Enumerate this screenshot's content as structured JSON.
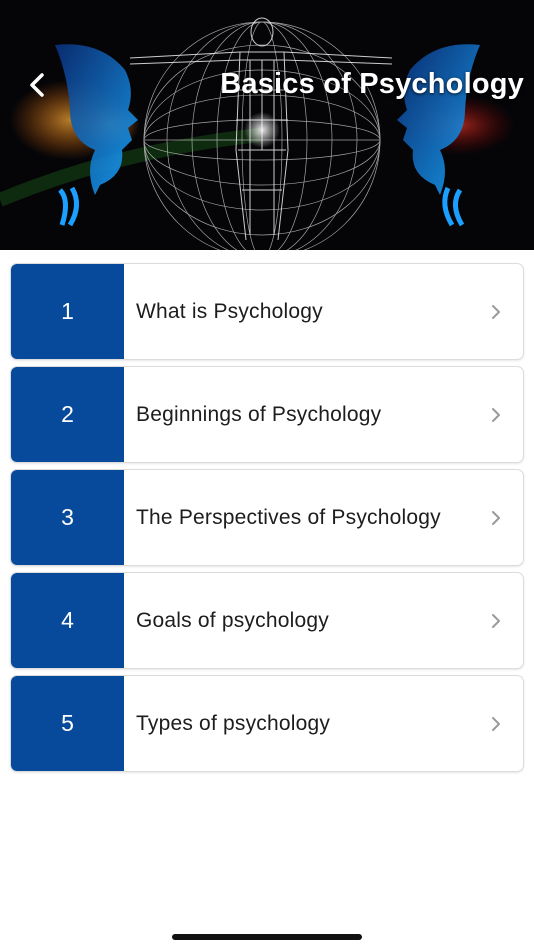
{
  "header": {
    "title": "Basics of Psychology",
    "back_icon": "chevron-left-icon"
  },
  "items": [
    {
      "number": "1",
      "label": "What is Psychology"
    },
    {
      "number": "2",
      "label": "Beginnings of Psychology"
    },
    {
      "number": "3",
      "label": "The Perspectives of Psychology"
    },
    {
      "number": "4",
      "label": "Goals of psychology"
    },
    {
      "number": "5",
      "label": "Types of psychology"
    }
  ],
  "colors": {
    "accent": "#074a9c",
    "header_bg": "#050508",
    "text": "#1d1d1d",
    "chevron": "#9a9a9a"
  }
}
